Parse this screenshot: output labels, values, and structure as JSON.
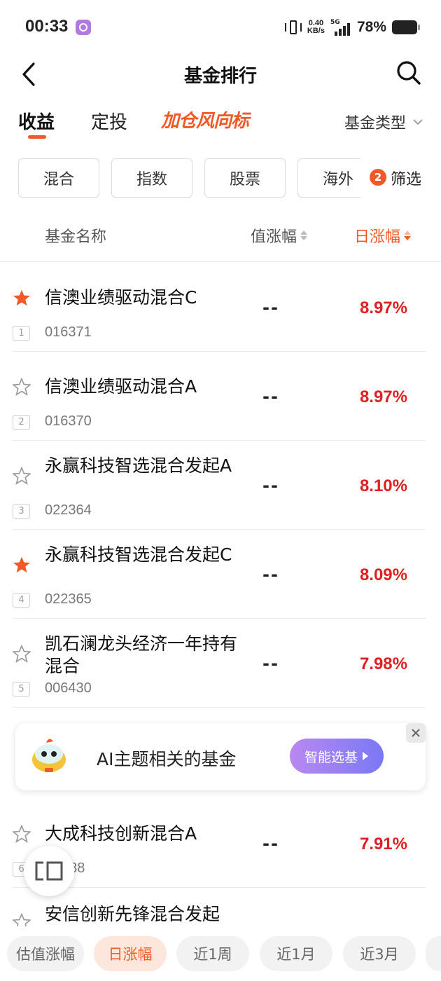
{
  "status_bar": {
    "time": "00:33",
    "net_speed_value": "0.40",
    "net_speed_unit": "KB/s",
    "network": "5G",
    "battery": "78%"
  },
  "header": {
    "title": "基金排行",
    "back_icon": "chevron-left-icon",
    "search_icon": "search-icon"
  },
  "tabs": {
    "income": "收益",
    "sip": "定投",
    "indicator": "加仓风向标",
    "fund_type": "基金类型"
  },
  "filters": {
    "chips": [
      "混合",
      "指数",
      "股票",
      "海外"
    ],
    "count": "2",
    "label": "筛选"
  },
  "columns": {
    "name": "基金名称",
    "est": "值涨幅",
    "daily": "日涨幅"
  },
  "funds": [
    {
      "name": "信澳业绩驱动混合C",
      "code": "016371",
      "rank": "1",
      "est": "--",
      "daily": "8.97%",
      "starred": true
    },
    {
      "name": "信澳业绩驱动混合A",
      "code": "016370",
      "rank": "2",
      "est": "--",
      "daily": "8.97%",
      "starred": false
    },
    {
      "name": "永赢科技智选混合发起A",
      "code": "022364",
      "rank": "3",
      "est": "--",
      "daily": "8.10%",
      "starred": false
    },
    {
      "name": "永赢科技智选混合发起C",
      "code": "022365",
      "rank": "4",
      "est": "--",
      "daily": "8.09%",
      "starred": true
    },
    {
      "name": "凯石澜龙头经济一年持有混合",
      "code": "006430",
      "rank": "5",
      "est": "--",
      "daily": "7.98%",
      "starred": false
    },
    {
      "name": "大成科技创新混合A",
      "code": "988",
      "rank": "6",
      "est": "--",
      "daily": "7.91%",
      "starred": false
    },
    {
      "name": "安信创新先锋混合发起",
      "code": "",
      "rank": "",
      "est": "",
      "daily": "",
      "starred": false
    }
  ],
  "ai_banner": {
    "text": "AI主题相关的基金",
    "button": "智能选基"
  },
  "bottom_sort": [
    "估值涨幅",
    "日涨幅",
    "近1周",
    "近1月",
    "近3月"
  ],
  "colors": {
    "accent": "#f05a28",
    "rise": "#e02020",
    "ai_button_start": "#b889f0",
    "ai_button_end": "#7a78f5"
  }
}
